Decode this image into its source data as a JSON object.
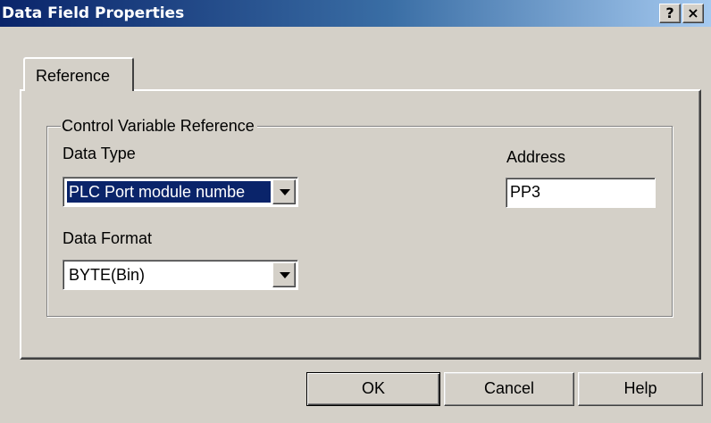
{
  "window": {
    "title": "Data Field Properties",
    "help_button": "?",
    "close_button": "×"
  },
  "tabs": [
    {
      "label": "Reference",
      "active": true
    }
  ],
  "group": {
    "legend": "Control Variable Reference",
    "data_type": {
      "label": "Data Type",
      "value": "PLC Port module numbe"
    },
    "data_format": {
      "label": "Data Format",
      "value": "BYTE(Bin)"
    },
    "address": {
      "label": "Address",
      "value": "PP3"
    }
  },
  "buttons": {
    "ok": "OK",
    "cancel": "Cancel",
    "help": "Help"
  },
  "colors": {
    "title_bar_start": "#0a246a",
    "title_bar_end": "#a6caf0",
    "dialog_face": "#d4d0c8",
    "selection": "#0a246a"
  }
}
